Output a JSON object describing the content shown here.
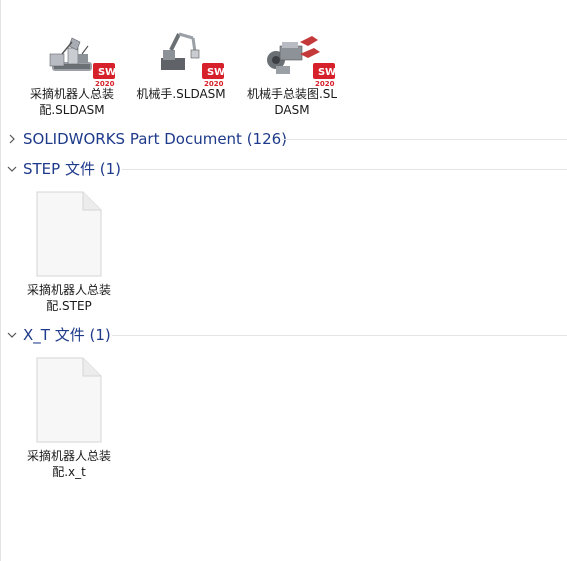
{
  "files_top": [
    {
      "label": "采摘机器人总装配.SLDASM",
      "icon": "assembly-robot-icon",
      "badge": "SW 2020"
    },
    {
      "label": "机械手.SLDASM",
      "icon": "assembly-arm-icon",
      "badge": "SW 2020"
    },
    {
      "label": "机械手总装图.SLDASM",
      "icon": "assembly-gripper-icon",
      "badge": "SW 2020"
    }
  ],
  "groups": [
    {
      "title": "SOLIDWORKS Part Document (126)",
      "state": "collapsed"
    },
    {
      "title": "STEP 文件 (1)",
      "state": "expanded"
    },
    {
      "title": "X_T 文件 (1)",
      "state": "expanded"
    }
  ],
  "step_files": [
    {
      "label": "采摘机器人总装配.STEP",
      "icon": "generic-document-icon"
    }
  ],
  "xt_files": [
    {
      "label": "采摘机器人总装配.x_t",
      "icon": "generic-document-icon"
    }
  ],
  "colors": {
    "group_title": "#1e3a8a",
    "badge_red": "#d6202a",
    "divider": "#e5e5e5"
  }
}
